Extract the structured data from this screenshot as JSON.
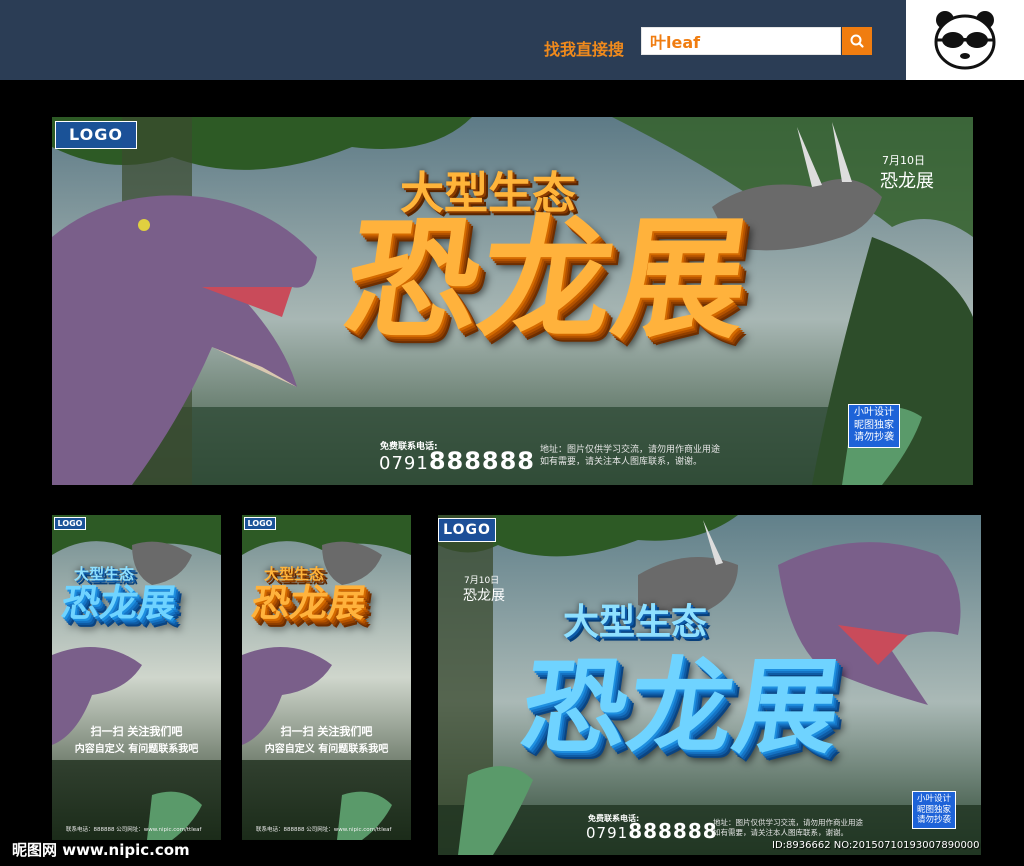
{
  "header": {
    "search_label": "找我直接搜",
    "search_value": "叶leaf",
    "search_icon": "search-icon",
    "logo_icon": "panda-logo-icon",
    "accent": "#f07d10",
    "bar_color": "#2b3d55"
  },
  "main_banner": {
    "logo": "LOGO",
    "title_sub": "大型生态",
    "title_main": "恐龙展",
    "date": "7月10日",
    "expo": "恐龙展",
    "phone_label": "免费联系电话:",
    "phone_prefix": "0791",
    "phone_number": "888888",
    "notice_1": "地址：图片仅供学习交流，请勿用作商业用途",
    "notice_2": "如有需要，请关注本人图库联系，谢谢。",
    "stamp": [
      "小叶设计",
      "昵图独家",
      "请勿抄袭"
    ]
  },
  "poster_blue": {
    "logo": "LOGO",
    "title_sub": "大型生态",
    "title_main": "恐龙展",
    "line_1": "扫一扫 关注我们吧",
    "line_2": "内容自定义 有问题联系我吧",
    "footer": "联系电话：888888  公司网址：www.nipic.com/ttleaf"
  },
  "poster_orange": {
    "logo": "LOGO",
    "title_sub": "大型生态",
    "title_main": "恐龙展",
    "line_1": "扫一扫 关注我们吧",
    "line_2": "内容自定义 有问题联系我吧",
    "footer": "联系电话：888888  公司网址：www.nipic.com/ttleaf"
  },
  "landscape_blue": {
    "logo": "LOGO",
    "title_sub": "大型生态",
    "title_main": "恐龙展",
    "date": "7月10日",
    "expo": "恐龙展",
    "phone_label": "免费联系电话:",
    "phone_prefix": "0791",
    "phone_number": "888888",
    "notice_1": "地址：图片仅供学习交流，请勿用作商业用途",
    "notice_2": "如有需要，请关注本人图库联系，谢谢。",
    "stamp": [
      "小叶设计",
      "昵图独家",
      "请勿抄袭"
    ]
  },
  "watermark": {
    "site": "昵图网 www.nipic.com",
    "id": "ID:8936662 NO:20150710193007890000"
  }
}
